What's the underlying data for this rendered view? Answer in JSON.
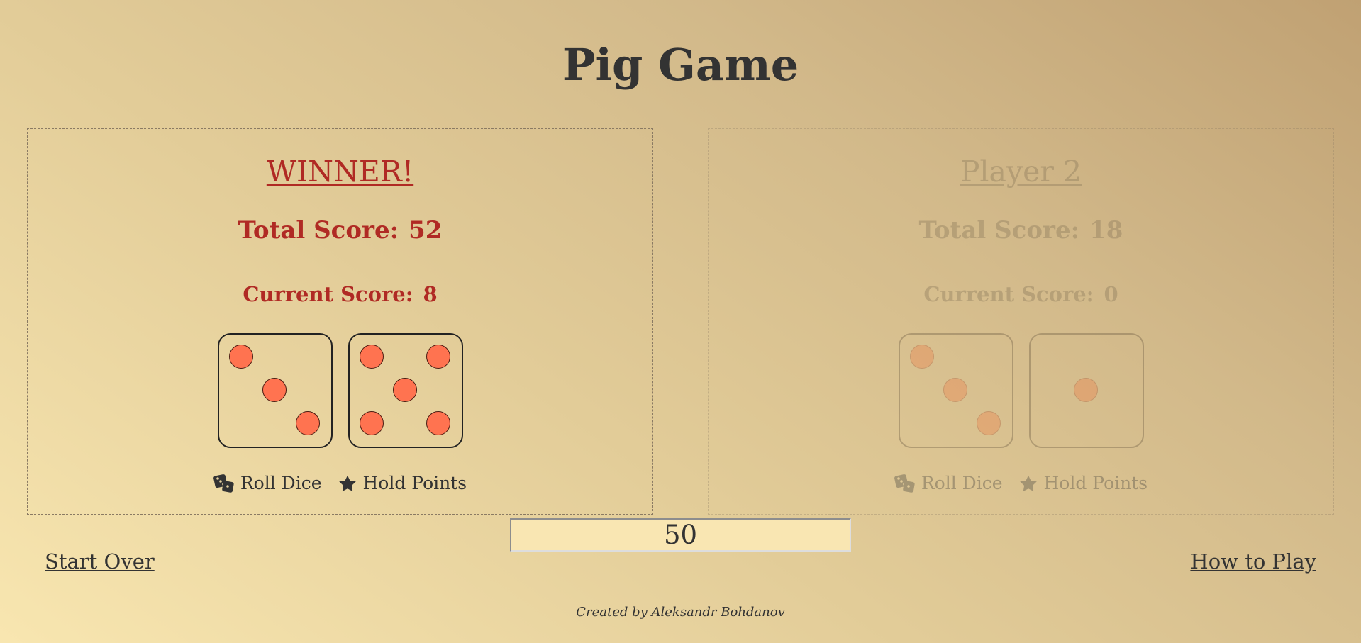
{
  "title": "Pig Game",
  "players": [
    {
      "name": "WINNER!",
      "total_label": "Total Score:",
      "total_score": "52",
      "current_label": "Current Score:",
      "current_score": "8",
      "dice": [
        3,
        5
      ],
      "roll_label": "Roll Dice",
      "hold_label": "Hold Points",
      "active": true
    },
    {
      "name": "Player 2",
      "total_label": "Total Score:",
      "total_score": "18",
      "current_label": "Current Score:",
      "current_score": "0",
      "dice": [
        3,
        1
      ],
      "roll_label": "Roll Dice",
      "hold_label": "Hold Points",
      "active": false
    }
  ],
  "target_score": "50",
  "start_over_label": "Start Over",
  "how_to_play_label": "How to Play",
  "credit": "Created by Aleksandr Bohdanov",
  "colors": {
    "winner_text": "#b02a24",
    "pip": "#ff7350",
    "input_bg": "#f9e6b2"
  },
  "icons": {
    "roll": "dice-icon",
    "hold": "star-icon"
  }
}
